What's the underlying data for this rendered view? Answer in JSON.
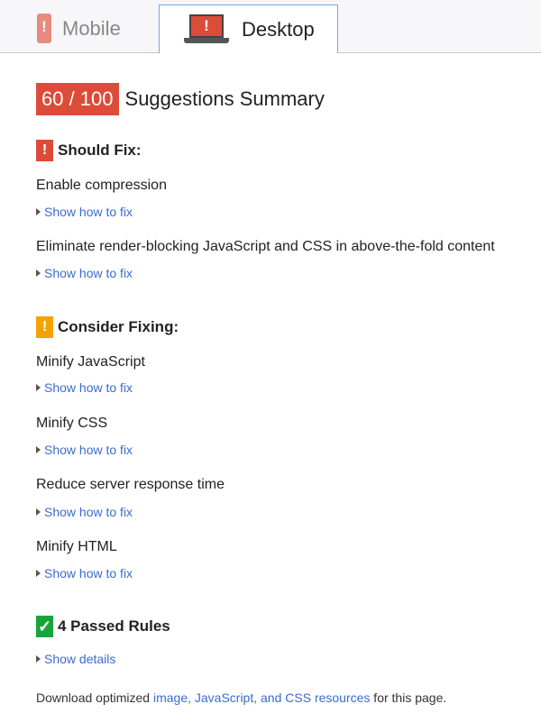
{
  "tabs": [
    {
      "label": "Mobile",
      "icon": "mobile-phone-warning-icon",
      "active": false
    },
    {
      "label": "Desktop",
      "icon": "laptop-warning-icon",
      "active": true
    }
  ],
  "summary": {
    "score": "60 / 100",
    "title": "Suggestions Summary",
    "score_color": "#dd4b39"
  },
  "sections": {
    "should_fix": {
      "badge": "!",
      "title": "Should Fix:",
      "color": "#dd4b39",
      "rules": [
        {
          "name": "Enable compression",
          "link": "Show how to fix"
        },
        {
          "name": "Eliminate render-blocking JavaScript and CSS in above-the-fold content",
          "link": "Show how to fix"
        }
      ]
    },
    "consider_fixing": {
      "badge": "!",
      "title": "Consider Fixing:",
      "color": "#f4a300",
      "rules": [
        {
          "name": "Minify JavaScript",
          "link": "Show how to fix"
        },
        {
          "name": "Minify CSS",
          "link": "Show how to fix"
        },
        {
          "name": "Reduce server response time",
          "link": "Show how to fix"
        },
        {
          "name": "Minify HTML",
          "link": "Show how to fix"
        }
      ]
    },
    "passed": {
      "badge": "✓",
      "title": "4 Passed Rules",
      "color": "#18a43a",
      "link": "Show details"
    }
  },
  "footer": {
    "prefix": "Download optimized ",
    "link": "image, JavaScript, and CSS resources",
    "suffix": " for this page."
  }
}
